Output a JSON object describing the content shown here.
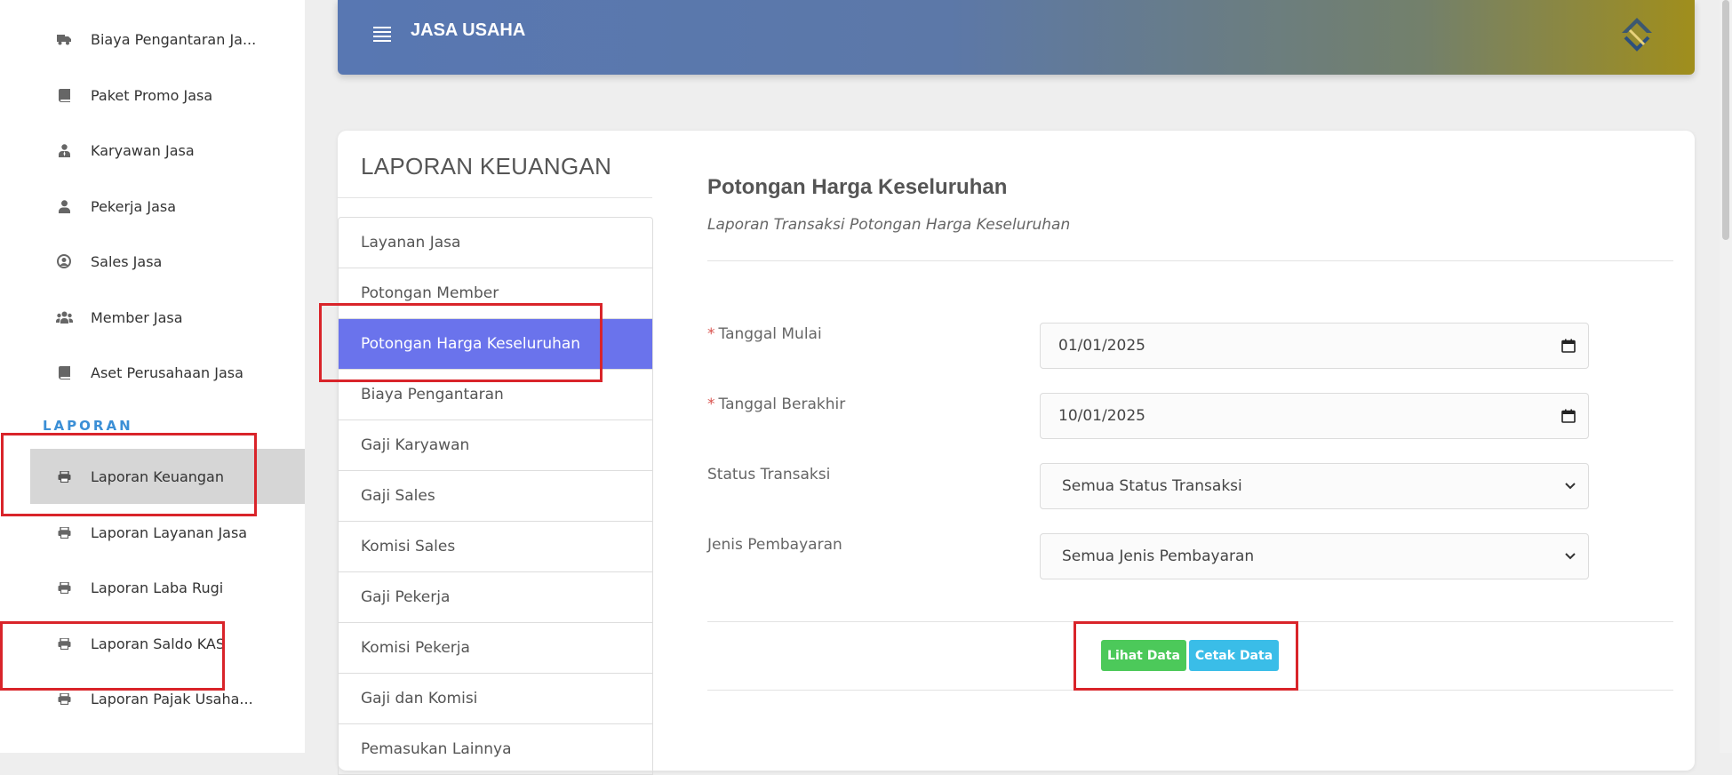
{
  "sidebar": {
    "items": [
      {
        "label": "Biaya Pengantaran Ja...",
        "icon": "truck-icon"
      },
      {
        "label": "Paket Promo Jasa",
        "icon": "book-icon"
      },
      {
        "label": "Karyawan Jasa",
        "icon": "user-tie-icon"
      },
      {
        "label": "Pekerja Jasa",
        "icon": "user-icon"
      },
      {
        "label": "Sales Jasa",
        "icon": "user-circle-icon"
      },
      {
        "label": "Member Jasa",
        "icon": "users-icon"
      },
      {
        "label": "Aset Perusahaan Jasa",
        "icon": "book-icon"
      }
    ],
    "section": "LAPORAN",
    "report_items": [
      {
        "label": "Laporan Keuangan",
        "icon": "printer-icon",
        "active": true
      },
      {
        "label": "Laporan Layanan Jasa",
        "icon": "printer-icon"
      },
      {
        "label": "Laporan Laba Rugi",
        "icon": "printer-icon"
      },
      {
        "label": "Laporan Saldo KAS",
        "icon": "printer-icon"
      },
      {
        "label": "Laporan Pajak Usaha...",
        "icon": "printer-icon"
      }
    ]
  },
  "header": {
    "title": "JASA USAHA"
  },
  "card": {
    "title": "LAPORAN KEUANGAN",
    "reports": [
      "Layanan Jasa",
      "Potongan Member",
      "Potongan Harga Keseluruhan",
      "Biaya Pengantaran",
      "Gaji Karyawan",
      "Gaji Sales",
      "Komisi Sales",
      "Gaji Pekerja",
      "Komisi Pekerja",
      "Gaji dan Komisi",
      "Pemasukan Lainnya"
    ],
    "active_report": "Potongan Harga Keseluruhan"
  },
  "form": {
    "title": "Potongan Harga Keseluruhan",
    "subtitle": "Laporan Transaksi Potongan Harga Keseluruhan",
    "required_mark": "*",
    "start_label": "Tanggal Mulai",
    "start_value": "01/01/2025",
    "end_label": "Tanggal Berakhir",
    "end_value": "10/01/2025",
    "status_label": "Status Transaksi",
    "status_value": "Semua Status Transaksi",
    "payment_label": "Jenis Pembayaran",
    "payment_value": "Semua Jenis Pembayaran",
    "view_button": "Lihat Data",
    "print_button": "Cetak Data"
  },
  "colors": {
    "active_report": "#6a73ec",
    "view_button": "#4cc95a",
    "print_button": "#3abde8",
    "annotation": "#d9242a"
  }
}
